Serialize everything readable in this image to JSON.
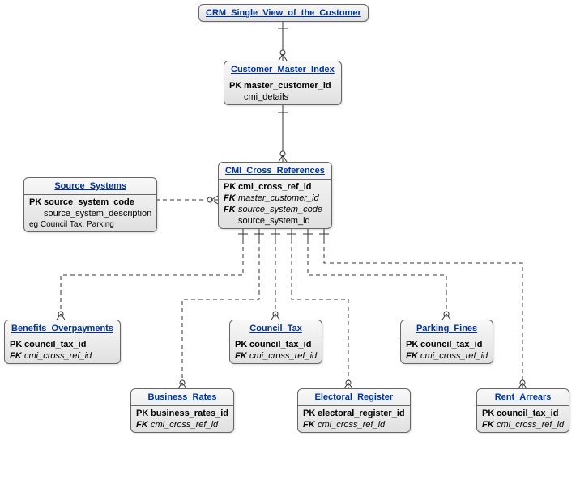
{
  "entities": {
    "crm": {
      "title": "CRM_Single_View_of_the_Customer",
      "attrs": []
    },
    "cmi": {
      "title": "Customer_Master_Index",
      "attrs": [
        {
          "key": "PK",
          "name": "master_customer_id",
          "kind": "pk"
        },
        {
          "key": "",
          "name": "cmi_details",
          "kind": ""
        }
      ]
    },
    "src": {
      "title": "Source_Systems",
      "attrs": [
        {
          "key": "PK",
          "name": "source_system_code",
          "kind": "pk"
        },
        {
          "key": "",
          "name": "source_system_description",
          "kind": ""
        }
      ],
      "note": "eg Council Tax, Parking"
    },
    "xref": {
      "title": "CMI_Cross_References",
      "attrs": [
        {
          "key": "PK",
          "name": "cmi_cross_ref_id",
          "kind": "pk"
        },
        {
          "key": "FK",
          "name": "master_customer_id",
          "kind": "fk"
        },
        {
          "key": "FK",
          "name": "source_system_code",
          "kind": "fk"
        },
        {
          "key": "",
          "name": "source_system_id",
          "kind": ""
        }
      ]
    },
    "benefits": {
      "title": "Benefits_Overpayments",
      "attrs": [
        {
          "key": "PK",
          "name": "council_tax_id",
          "kind": "pk"
        },
        {
          "key": "FK",
          "name": "cmi_cross_ref_id",
          "kind": "fk"
        }
      ]
    },
    "business": {
      "title": "Business_Rates",
      "attrs": [
        {
          "key": "PK",
          "name": "business_rates_id",
          "kind": "pk"
        },
        {
          "key": "FK",
          "name": "cmi_cross_ref_id",
          "kind": "fk"
        }
      ]
    },
    "council": {
      "title": "Council_Tax",
      "attrs": [
        {
          "key": "PK",
          "name": "council_tax_id",
          "kind": "pk"
        },
        {
          "key": "FK",
          "name": "cmi_cross_ref_id",
          "kind": "fk"
        }
      ]
    },
    "electoral": {
      "title": "Electoral_Register",
      "attrs": [
        {
          "key": "PK",
          "name": "electoral_register_id",
          "kind": "pk"
        },
        {
          "key": "FK",
          "name": "cmi_cross_ref_id",
          "kind": "fk"
        }
      ]
    },
    "parking": {
      "title": "Parking_Fines",
      "attrs": [
        {
          "key": "PK",
          "name": "council_tax_id",
          "kind": "pk"
        },
        {
          "key": "FK",
          "name": "cmi_cross_ref_id",
          "kind": "fk"
        }
      ]
    },
    "rent": {
      "title": "Rent_Arrears",
      "attrs": [
        {
          "key": "PK",
          "name": "council_tax_id",
          "kind": "pk"
        },
        {
          "key": "FK",
          "name": "cmi_cross_ref_id",
          "kind": "fk"
        }
      ]
    }
  }
}
